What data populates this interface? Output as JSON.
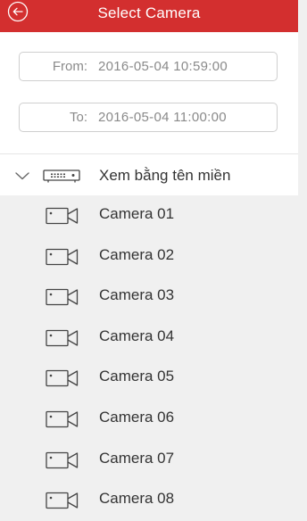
{
  "header": {
    "title": "Select Camera",
    "background": "#d32f2f",
    "back_icon": "back-arrow-circle-icon"
  },
  "time_range": {
    "from_label": "From:",
    "from_value": "2016-05-04 10:59:00",
    "to_label": "To:",
    "to_value": "2016-05-04 11:00:00"
  },
  "device_group": {
    "label": "Xem bằng tên miền",
    "expand_icon": "chevron-down-icon",
    "device_icon": "dvr-icon"
  },
  "cameras": [
    {
      "label": "Camera 01",
      "icon": "camera-icon"
    },
    {
      "label": "Camera 02",
      "icon": "camera-icon"
    },
    {
      "label": "Camera 03",
      "icon": "camera-icon"
    },
    {
      "label": "Camera 04",
      "icon": "camera-icon"
    },
    {
      "label": "Camera 05",
      "icon": "camera-icon"
    },
    {
      "label": "Camera 06",
      "icon": "camera-icon"
    },
    {
      "label": "Camera 07",
      "icon": "camera-icon"
    },
    {
      "label": "Camera 08",
      "icon": "camera-icon"
    }
  ]
}
